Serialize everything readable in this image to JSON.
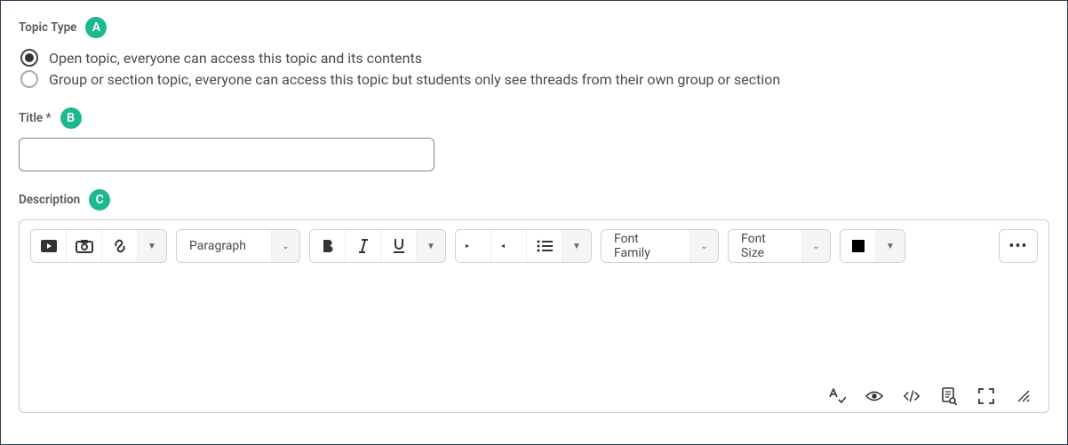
{
  "topicType": {
    "label": "Topic Type",
    "badge": "A",
    "options": [
      {
        "label": "Open topic, everyone can access this topic and its contents",
        "selected": true
      },
      {
        "label": "Group or section topic, everyone can access this topic but students only see threads from their own group or section",
        "selected": false
      }
    ]
  },
  "title": {
    "label": "Title *",
    "badge": "B",
    "value": ""
  },
  "description": {
    "label": "Description",
    "badge": "C",
    "toolbar": {
      "paragraph": "Paragraph",
      "fontFamily": "Font Family",
      "fontSize": "Font Size",
      "more": "•••"
    }
  }
}
